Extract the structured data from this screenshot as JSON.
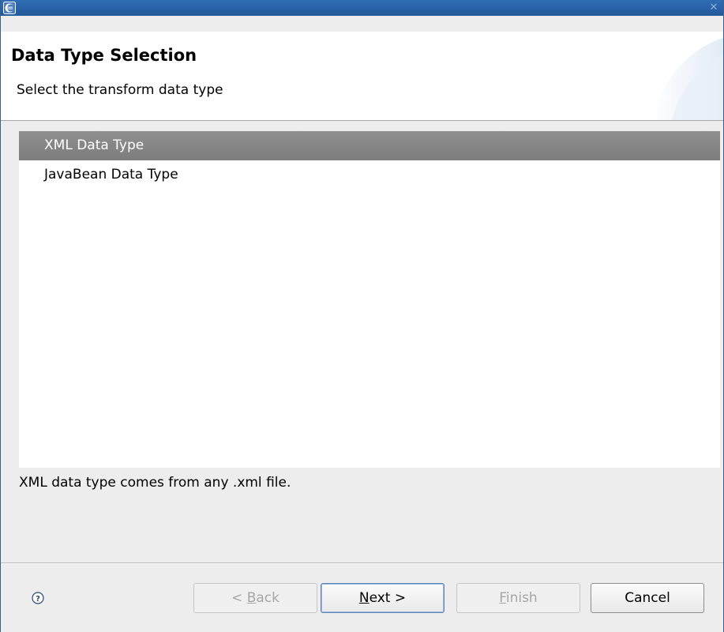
{
  "window": {
    "app_icon": "eclipse-icon",
    "close_icon": "close-icon"
  },
  "header": {
    "title": "Data Type Selection",
    "subtitle": "Select the transform data type"
  },
  "list": {
    "items": [
      {
        "label": "XML Data Type",
        "selected": true
      },
      {
        "label": "JavaBean Data Type",
        "selected": false
      }
    ]
  },
  "description": "XML data type comes from any .xml file.",
  "buttons": {
    "help_icon": "help-icon",
    "back": {
      "pre": "< ",
      "mnemonic": "B",
      "post": "ack",
      "enabled": false
    },
    "next": {
      "pre": "",
      "mnemonic": "N",
      "post": "ext >",
      "enabled": true
    },
    "finish": {
      "pre": "",
      "mnemonic": "F",
      "post": "inish",
      "enabled": false
    },
    "cancel": {
      "label": "Cancel",
      "enabled": true
    }
  },
  "colors": {
    "titlebar": "#2f6db5",
    "selection": "#878787",
    "background": "#ededed"
  }
}
